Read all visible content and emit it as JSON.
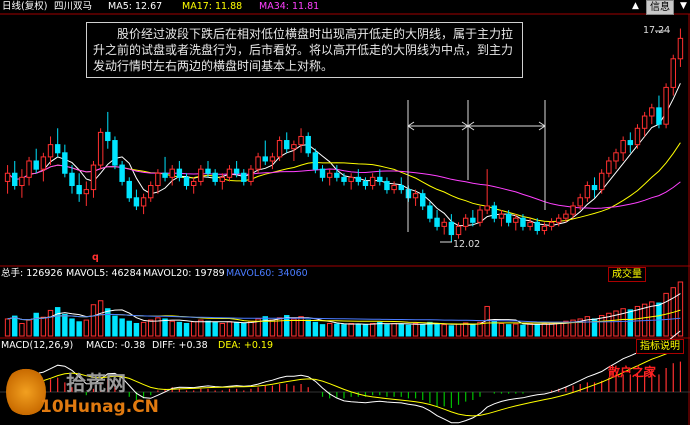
{
  "header": {
    "period_label": "日线(复权)",
    "stock_name": "四川双马",
    "ma_labels": [
      {
        "text": "MA5: 12.67",
        "color": "#ffffff"
      },
      {
        "text": "MA17: 11.88",
        "color": "#ffff00"
      },
      {
        "text": "MA34: 11.81",
        "color": "#ff40ff"
      }
    ],
    "info_button": "信息"
  },
  "annotation": "股价经过波段下跌后在相对低位横盘时出现高开低走的大阴线，属于主力拉升之前的试盘或者洗盘行为，后市看好。将以高开低走的大阴线为中点，到主力发动行情时左右两边的横盘时间基本上对称。",
  "volume_header": {
    "labels": [
      {
        "text": "总手: 126926",
        "color": "#ffffff"
      },
      {
        "text": "MAVOL5: 46284",
        "color": "#ffffff"
      },
      {
        "text": "MAVOL20: 19789",
        "color": "#ffffff"
      },
      {
        "text": "MAVOL60: 34060",
        "color": "#4a7bff"
      }
    ],
    "button": "成交量"
  },
  "macd_header": {
    "labels": [
      {
        "text": "MACD(12,26,9)",
        "color": "#ffffff"
      },
      {
        "text": "MACD: -0.38",
        "color": "#ffffff"
      },
      {
        "text": "DIFF: +0.38",
        "color": "#ffffff"
      },
      {
        "text": "DEA: +0.19",
        "color": "#ffff00"
      }
    ],
    "button": "指标说明"
  },
  "watermark": {
    "line1": "拾荒网",
    "line2": "10Hunag.CN",
    "right_text": "散户之家"
  },
  "chart_data": {
    "type": "candlestick",
    "price_labels": {
      "high": "17.24",
      "low": "12.02",
      "q_mark": "q"
    },
    "colors": {
      "up": "#ff3030",
      "down": "#00e5ff",
      "ma5": "#ffffff",
      "ma17": "#ffff00",
      "ma34": "#ff40ff"
    },
    "candles": [
      [
        13.5,
        13.9,
        13.2,
        13.7
      ],
      [
        13.7,
        14.0,
        13.3,
        13.4
      ],
      [
        13.4,
        13.8,
        13.1,
        13.6
      ],
      [
        13.6,
        14.1,
        13.4,
        14.0
      ],
      [
        14.0,
        14.3,
        13.7,
        13.8
      ],
      [
        13.8,
        14.2,
        13.5,
        14.1
      ],
      [
        14.1,
        14.6,
        13.9,
        14.4
      ],
      [
        14.4,
        14.8,
        14.1,
        14.2
      ],
      [
        14.2,
        14.4,
        13.6,
        13.7
      ],
      [
        13.7,
        13.9,
        13.2,
        13.4
      ],
      [
        13.4,
        13.7,
        13.0,
        13.2
      ],
      [
        13.2,
        13.5,
        12.9,
        13.3
      ],
      [
        13.3,
        14.0,
        13.1,
        13.9
      ],
      [
        13.9,
        14.8,
        13.8,
        14.7
      ],
      [
        14.7,
        15.2,
        14.3,
        14.5
      ],
      [
        14.5,
        14.6,
        13.8,
        13.9
      ],
      [
        13.9,
        14.0,
        13.4,
        13.5
      ],
      [
        13.5,
        13.6,
        13.0,
        13.1
      ],
      [
        13.1,
        13.3,
        12.8,
        12.9
      ],
      [
        12.9,
        13.2,
        12.7,
        13.1
      ],
      [
        13.1,
        13.5,
        13.0,
        13.4
      ],
      [
        13.4,
        13.8,
        13.2,
        13.7
      ],
      [
        13.7,
        14.1,
        13.5,
        13.6
      ],
      [
        13.6,
        13.9,
        13.4,
        13.8
      ],
      [
        13.8,
        14.0,
        13.5,
        13.6
      ],
      [
        13.6,
        13.7,
        13.3,
        13.4
      ],
      [
        13.4,
        13.6,
        13.2,
        13.5
      ],
      [
        13.5,
        13.9,
        13.4,
        13.8
      ],
      [
        13.8,
        14.0,
        13.6,
        13.7
      ],
      [
        13.7,
        13.8,
        13.4,
        13.5
      ],
      [
        13.5,
        13.7,
        13.3,
        13.6
      ],
      [
        13.6,
        13.9,
        13.5,
        13.8
      ],
      [
        13.8,
        14.0,
        13.6,
        13.7
      ],
      [
        13.7,
        13.8,
        13.4,
        13.5
      ],
      [
        13.5,
        13.9,
        13.4,
        13.8
      ],
      [
        13.8,
        14.2,
        13.7,
        14.1
      ],
      [
        14.1,
        14.5,
        13.9,
        14.0
      ],
      [
        14.0,
        14.2,
        13.8,
        14.1
      ],
      [
        14.1,
        14.6,
        14.0,
        14.5
      ],
      [
        14.5,
        14.7,
        14.2,
        14.3
      ],
      [
        14.3,
        14.5,
        14.0,
        14.4
      ],
      [
        14.4,
        14.8,
        14.2,
        14.6
      ],
      [
        14.6,
        14.7,
        14.1,
        14.2
      ],
      [
        14.2,
        14.3,
        13.7,
        13.8
      ],
      [
        13.8,
        13.9,
        13.5,
        13.6
      ],
      [
        13.6,
        13.8,
        13.4,
        13.7
      ],
      [
        13.7,
        13.9,
        13.5,
        13.6
      ],
      [
        13.6,
        13.7,
        13.4,
        13.5
      ],
      [
        13.5,
        13.7,
        13.3,
        13.6
      ],
      [
        13.6,
        13.8,
        13.4,
        13.5
      ],
      [
        13.5,
        13.6,
        13.3,
        13.4
      ],
      [
        13.4,
        13.7,
        13.3,
        13.6
      ],
      [
        13.6,
        13.8,
        13.4,
        13.5
      ],
      [
        13.5,
        13.6,
        13.2,
        13.3
      ],
      [
        13.3,
        13.5,
        13.2,
        13.4
      ],
      [
        13.4,
        13.6,
        13.2,
        13.3
      ],
      [
        13.3,
        13.4,
        13.0,
        13.1
      ],
      [
        13.1,
        13.3,
        12.9,
        13.2
      ],
      [
        13.2,
        13.3,
        12.8,
        12.9
      ],
      [
        12.9,
        13.0,
        12.5,
        12.6
      ],
      [
        12.6,
        12.8,
        12.3,
        12.4
      ],
      [
        12.4,
        12.6,
        12.2,
        12.5
      ],
      [
        12.5,
        12.7,
        12.02,
        12.2
      ],
      [
        12.2,
        12.5,
        12.1,
        12.4
      ],
      [
        12.4,
        12.7,
        12.3,
        12.6
      ],
      [
        12.6,
        12.8,
        12.4,
        12.5
      ],
      [
        12.5,
        12.9,
        12.4,
        12.8
      ],
      [
        12.8,
        13.8,
        12.7,
        12.9
      ],
      [
        12.9,
        13.0,
        12.5,
        12.6
      ],
      [
        12.6,
        12.8,
        12.4,
        12.7
      ],
      [
        12.7,
        12.8,
        12.4,
        12.5
      ],
      [
        12.5,
        12.7,
        12.3,
        12.6
      ],
      [
        12.6,
        12.7,
        12.3,
        12.4
      ],
      [
        12.4,
        12.6,
        12.3,
        12.5
      ],
      [
        12.5,
        12.6,
        12.2,
        12.3
      ],
      [
        12.3,
        12.5,
        12.2,
        12.4
      ],
      [
        12.4,
        12.6,
        12.3,
        12.5
      ],
      [
        12.5,
        12.7,
        12.4,
        12.6
      ],
      [
        12.6,
        12.8,
        12.5,
        12.7
      ],
      [
        12.7,
        13.0,
        12.6,
        12.9
      ],
      [
        12.9,
        13.2,
        12.8,
        13.1
      ],
      [
        13.1,
        13.5,
        13.0,
        13.4
      ],
      [
        13.4,
        13.6,
        13.1,
        13.3
      ],
      [
        13.3,
        13.8,
        13.2,
        13.7
      ],
      [
        13.7,
        14.1,
        13.6,
        14.0
      ],
      [
        14.0,
        14.3,
        13.8,
        14.2
      ],
      [
        14.2,
        14.6,
        14.0,
        14.5
      ],
      [
        14.5,
        14.7,
        14.2,
        14.4
      ],
      [
        14.4,
        14.9,
        14.3,
        14.8
      ],
      [
        14.8,
        15.2,
        14.6,
        15.1
      ],
      [
        15.1,
        15.4,
        14.9,
        15.3
      ],
      [
        15.3,
        15.6,
        14.8,
        14.9
      ],
      [
        14.9,
        15.9,
        14.8,
        15.8
      ],
      [
        15.8,
        16.6,
        15.6,
        16.5
      ],
      [
        16.5,
        17.24,
        16.3,
        17.0
      ]
    ],
    "volumes": [
      30,
      35,
      22,
      28,
      40,
      33,
      45,
      50,
      38,
      30,
      25,
      28,
      55,
      62,
      48,
      35,
      30,
      26,
      22,
      24,
      28,
      32,
      30,
      26,
      24,
      22,
      25,
      28,
      26,
      24,
      22,
      25,
      24,
      22,
      26,
      30,
      34,
      28,
      32,
      36,
      30,
      34,
      28,
      24,
      20,
      22,
      21,
      20,
      22,
      21,
      20,
      22,
      24,
      20,
      22,
      21,
      19,
      22,
      20,
      24,
      22,
      20,
      18,
      21,
      23,
      20,
      24,
      52,
      26,
      22,
      20,
      21,
      19,
      22,
      20,
      21,
      22,
      24,
      26,
      28,
      30,
      34,
      30,
      36,
      40,
      44,
      48,
      46,
      52,
      56,
      60,
      58,
      75,
      85,
      95
    ],
    "macd_hist": [
      0.1,
      0.12,
      0.08,
      0.1,
      0.14,
      0.12,
      0.16,
      0.18,
      0.12,
      0.06,
      0.0,
      -0.04,
      0.04,
      0.12,
      0.16,
      0.1,
      0.02,
      -0.06,
      -0.1,
      -0.08,
      -0.04,
      0.02,
      0.04,
      0.06,
      0.04,
      0.02,
      0.02,
      0.04,
      0.04,
      0.02,
      0.02,
      0.04,
      0.04,
      0.02,
      0.04,
      0.06,
      0.08,
      0.08,
      0.1,
      0.1,
      0.08,
      0.1,
      0.06,
      0.0,
      -0.06,
      -0.08,
      -0.08,
      -0.08,
      -0.06,
      -0.06,
      -0.06,
      -0.04,
      -0.04,
      -0.06,
      -0.06,
      -0.06,
      -0.08,
      -0.08,
      -0.1,
      -0.14,
      -0.18,
      -0.18,
      -0.2,
      -0.16,
      -0.12,
      -0.1,
      -0.06,
      0.0,
      -0.02,
      -0.02,
      -0.02,
      -0.02,
      -0.02,
      0.0,
      0.0,
      0.0,
      0.02,
      0.04,
      0.06,
      0.08,
      0.1,
      0.12,
      0.12,
      0.14,
      0.18,
      0.2,
      0.22,
      0.22,
      0.24,
      0.26,
      0.28,
      0.22,
      0.3,
      0.36,
      0.38
    ]
  }
}
